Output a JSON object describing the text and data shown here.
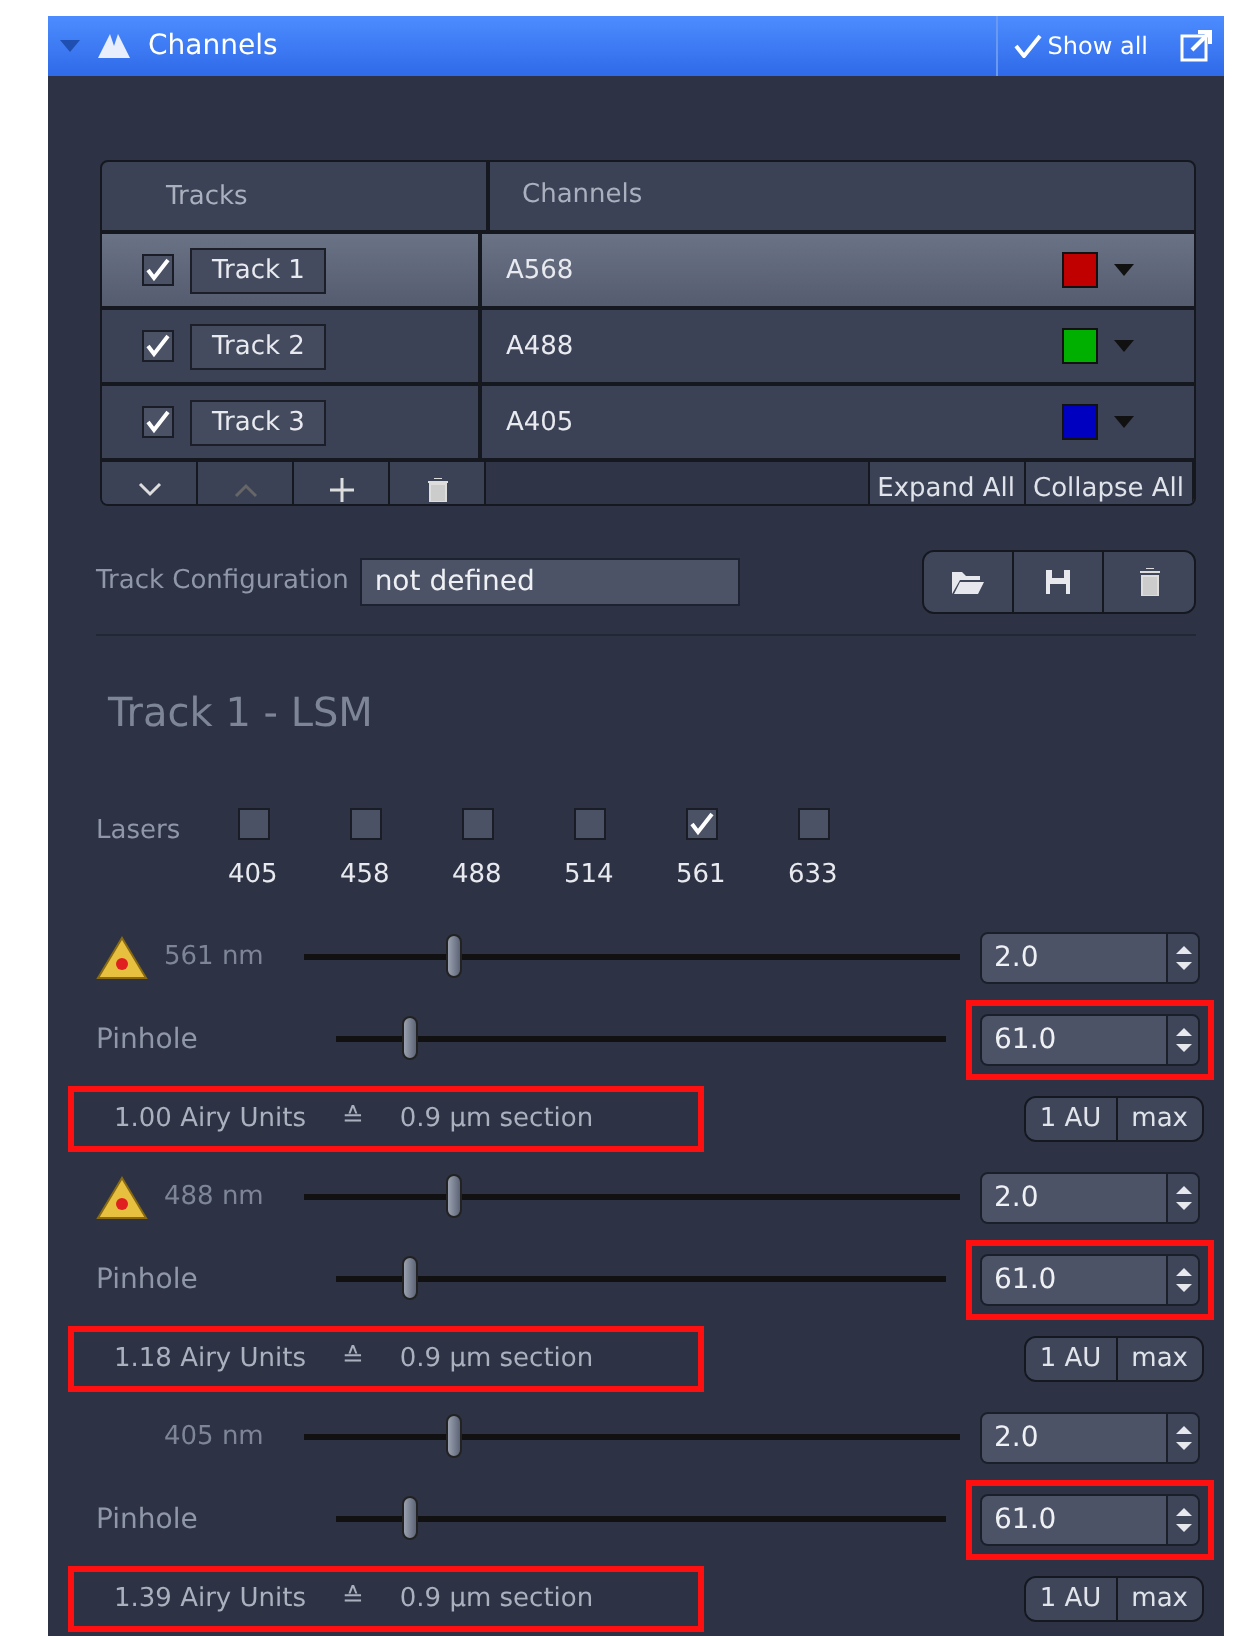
{
  "header": {
    "title": "Channels",
    "show_all": "Show all",
    "expanded": true
  },
  "tracks_table": {
    "columns": [
      "Tracks",
      "Channels"
    ],
    "rows": [
      {
        "checked": true,
        "track": "Track 1",
        "channel": "A568",
        "color": "#c00000",
        "selected": true
      },
      {
        "checked": true,
        "track": "Track 2",
        "channel": "A488",
        "color": "#00b000",
        "selected": false
      },
      {
        "checked": true,
        "track": "Track 3",
        "channel": "A405",
        "color": "#0000c0",
        "selected": false
      }
    ],
    "toolbar": {
      "expand": "Expand All",
      "collapse": "Collapse All"
    }
  },
  "track_configuration": {
    "label": "Track Configuration",
    "value": "not defined"
  },
  "track_title": "Track 1 - LSM",
  "lasers": {
    "label": "Lasers",
    "items": [
      {
        "wavelength": "405",
        "checked": false
      },
      {
        "wavelength": "458",
        "checked": false
      },
      {
        "wavelength": "488",
        "checked": false
      },
      {
        "wavelength": "514",
        "checked": false
      },
      {
        "wavelength": "561",
        "checked": true
      },
      {
        "wavelength": "633",
        "checked": false
      }
    ]
  },
  "laser_sections": [
    {
      "warning": true,
      "wavelength": "561 nm",
      "level": 0.23,
      "value": "2.0",
      "pinhole": {
        "label": "Pinhole",
        "level": 0.12,
        "value": "61.0",
        "highlighted": true
      },
      "airy": {
        "units": "1.00 Airy Units",
        "symbol": "≙",
        "section": "0.9 µm section",
        "highlighted": true
      },
      "buttons": [
        "1 AU",
        "max"
      ]
    },
    {
      "warning": true,
      "wavelength": "488 nm",
      "level": 0.23,
      "value": "2.0",
      "pinhole": {
        "label": "Pinhole",
        "level": 0.12,
        "value": "61.0",
        "highlighted": true
      },
      "airy": {
        "units": "1.18 Airy Units",
        "symbol": "≙",
        "section": "0.9 µm section",
        "highlighted": true
      },
      "buttons": [
        "1 AU",
        "max"
      ]
    },
    {
      "warning": false,
      "wavelength": "405 nm",
      "level": 0.23,
      "value": "2.0",
      "pinhole": {
        "label": "Pinhole",
        "level": 0.12,
        "value": "61.0",
        "highlighted": true
      },
      "airy": {
        "units": "1.39 Airy Units",
        "symbol": "≙",
        "section": "0.9 µm section",
        "highlighted": true
      },
      "buttons": [
        "1 AU",
        "max"
      ]
    }
  ]
}
